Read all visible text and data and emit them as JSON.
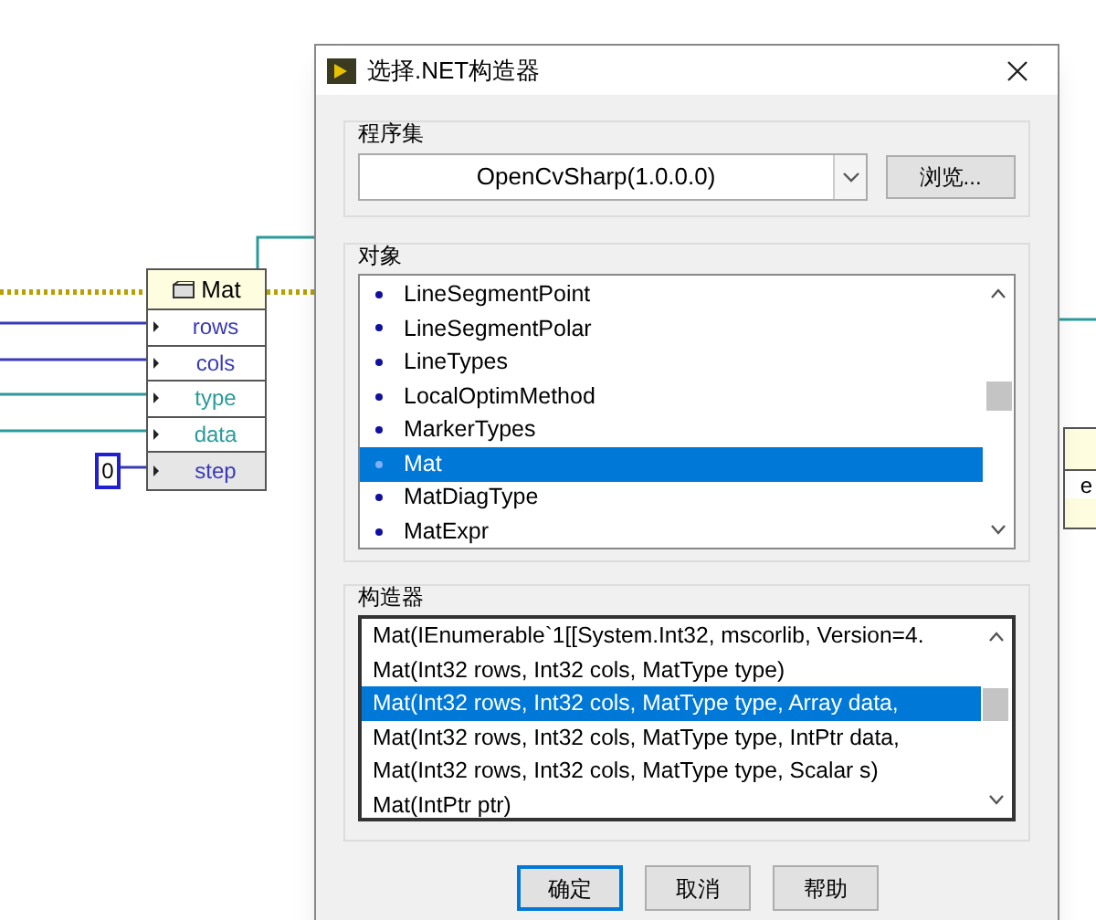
{
  "diagram": {
    "node": {
      "title": "Mat",
      "terminals": [
        {
          "label": "rows",
          "color": "#3a3ab8",
          "highlighted": false
        },
        {
          "label": "cols",
          "color": "#3a3ab8",
          "highlighted": false
        },
        {
          "label": "type",
          "color": "#2a9a9a",
          "highlighted": false
        },
        {
          "label": "data",
          "color": "#2a9a9a",
          "highlighted": false
        },
        {
          "label": "step",
          "color": "#3a3ab8",
          "highlighted": true
        }
      ]
    },
    "constant": "0",
    "partial_node_label": "e"
  },
  "dialog": {
    "title": "选择.NET构造器",
    "assembly": {
      "label": "程序集",
      "value": "OpenCvSharp(1.0.0.0)",
      "browse": "浏览..."
    },
    "objects": {
      "label": "对象",
      "items": [
        {
          "name": "LineSegmentPoint",
          "selected": false
        },
        {
          "name": "LineSegmentPolar",
          "selected": false
        },
        {
          "name": "LineTypes",
          "selected": false
        },
        {
          "name": "LocalOptimMethod",
          "selected": false
        },
        {
          "name": "MarkerTypes",
          "selected": false
        },
        {
          "name": "Mat",
          "selected": true
        },
        {
          "name": "MatDiagType",
          "selected": false
        },
        {
          "name": "MatExpr",
          "selected": false
        }
      ]
    },
    "constructors": {
      "label": "构造器",
      "items": [
        {
          "name": "Mat(IEnumerable`1[[System.Int32, mscorlib, Version=4.",
          "selected": false
        },
        {
          "name": "Mat(Int32 rows, Int32 cols, MatType type)",
          "selected": false
        },
        {
          "name": "Mat(Int32 rows, Int32 cols, MatType type, Array data,",
          "selected": true
        },
        {
          "name": "Mat(Int32 rows, Int32 cols, MatType type, IntPtr data,",
          "selected": false
        },
        {
          "name": "Mat(Int32 rows, Int32 cols, MatType type, Scalar s)",
          "selected": false
        },
        {
          "name": "Mat(IntPtr ptr)",
          "selected": false
        }
      ]
    },
    "buttons": [
      "确定",
      "取消",
      "帮助"
    ]
  }
}
